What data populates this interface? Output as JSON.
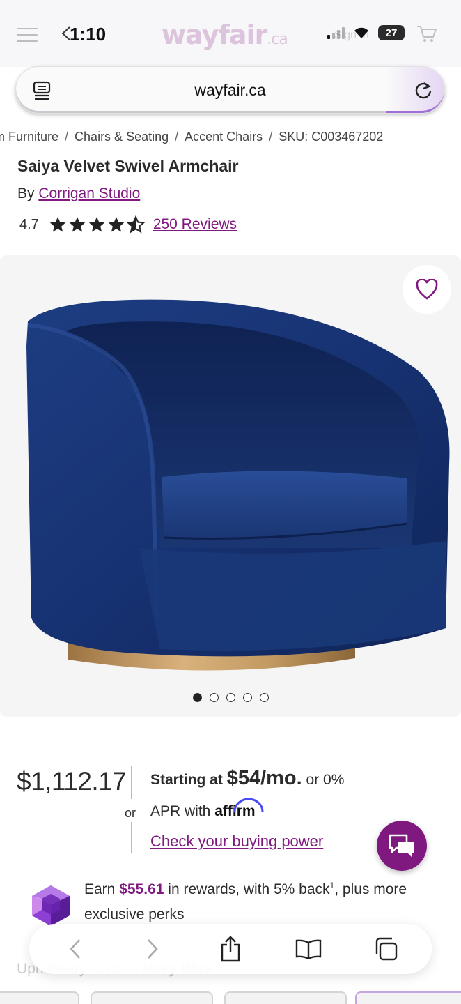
{
  "status_bar": {
    "time": "1:10",
    "battery": "27"
  },
  "site_header_faded": {
    "logo_text": "wayfair",
    "logo_tld": ".ca",
    "sign_in": "Sign In"
  },
  "browser": {
    "url": "wayfair.ca"
  },
  "breadcrumb": {
    "items": [
      "m Furniture",
      "Chairs & Seating",
      "Accent Chairs",
      "SKU: C003467202"
    ]
  },
  "product": {
    "title": "Saiya Velvet Swivel Armchair",
    "by_prefix": "By",
    "brand": "Corrigan Studio",
    "rating_value": "4.7",
    "rating_stars": 4.7,
    "reviews_link": "250 Reviews",
    "image_description_colors": {
      "velvet": "#1c3a7a",
      "base": "#c49a63"
    },
    "gallery_dots": 5,
    "gallery_active_index": 0
  },
  "pricing": {
    "price": "$1,112.17",
    "or_label": "or",
    "starting_at": "Starting at",
    "monthly": "$54/mo.",
    "or_zero": "or 0%",
    "apr_with": "APR with",
    "affirm": "affirm",
    "check_link": "Check your buying power"
  },
  "rewards": {
    "earn_prefix": "Earn",
    "amount": "$55.61",
    "mid": "in rewards, with 5% back",
    "sup": "1",
    "suffix": ", plus more exclusive perks"
  },
  "options": {
    "label": "Upholstery Colour:",
    "value": "Navy Blue"
  },
  "colors": {
    "brand_purple": "#7f187f",
    "text": "#2b2b2b"
  }
}
